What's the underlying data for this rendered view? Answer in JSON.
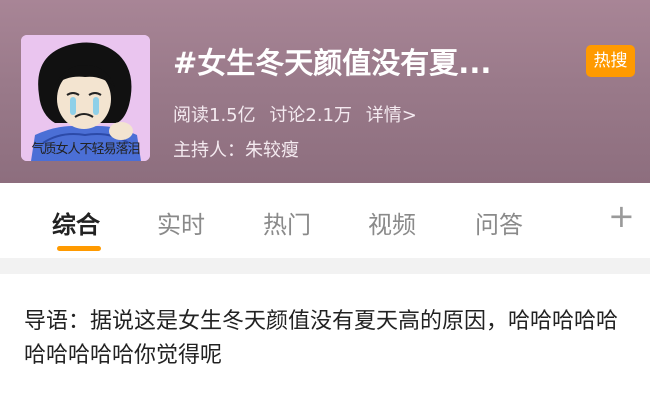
{
  "header": {
    "thumbnail_caption": "气质女人不轻易落泪",
    "title": "#女生冬天颜值没有夏...",
    "hot_badge": "热搜",
    "stats": {
      "reads": "阅读1.5亿",
      "discussions": "讨论2.1万",
      "details": "详情>"
    },
    "host": "主持人：朱较瘦"
  },
  "tabs": [
    {
      "label": "综合",
      "active": true
    },
    {
      "label": "实时",
      "active": false
    },
    {
      "label": "热门",
      "active": false
    },
    {
      "label": "视频",
      "active": false
    },
    {
      "label": "问答",
      "active": false
    }
  ],
  "tab_plus": "+",
  "intro": {
    "text": "导语：据说这是女生冬天颜值没有夏天高的原因，哈哈哈哈哈哈哈哈哈哈你觉得呢"
  },
  "colors": {
    "accent": "#ff9a00",
    "header_bg": "#9a7a8a"
  }
}
